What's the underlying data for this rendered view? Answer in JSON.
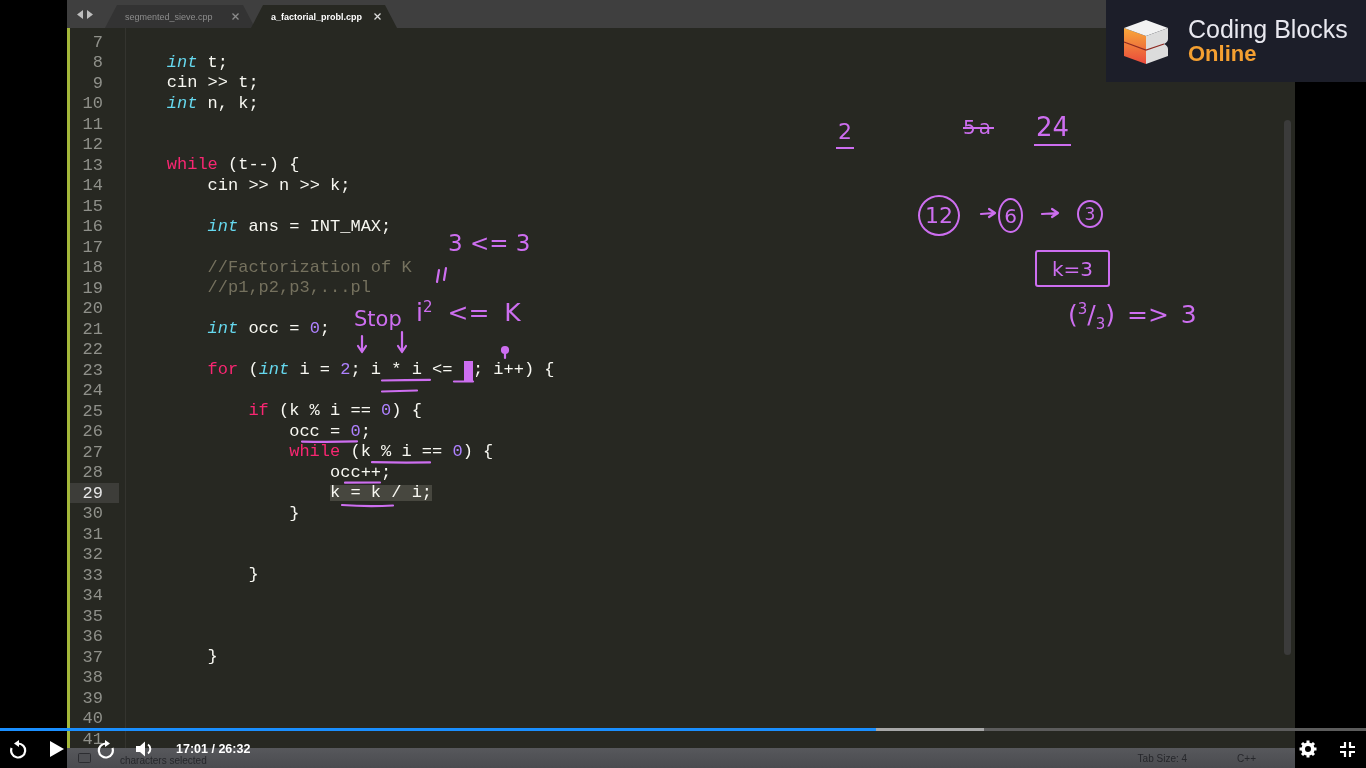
{
  "editor": {
    "tabs": [
      {
        "label": "segmented_sieve.cpp",
        "selected": false
      },
      {
        "label": "a_factorial_probl.cpp",
        "selected": true
      }
    ],
    "lines": [
      {
        "number": "7",
        "selected": false
      },
      {
        "number": "8",
        "selected": false,
        "tokens": [
          {
            "kind": "type",
            "text": "int"
          },
          {
            "kind": "plain",
            "text": " t;"
          }
        ]
      },
      {
        "number": "9",
        "selected": false,
        "tokens": [
          {
            "kind": "plain",
            "text": "cin >> t;"
          }
        ]
      },
      {
        "number": "10",
        "selected": false,
        "tokens": [
          {
            "kind": "type",
            "text": "int"
          },
          {
            "kind": "plain",
            "text": " n, k;"
          }
        ]
      },
      {
        "number": "11",
        "selected": false
      },
      {
        "number": "12",
        "selected": false
      },
      {
        "number": "13",
        "selected": false,
        "tokens": [
          {
            "kind": "keyword",
            "text": "while"
          },
          {
            "kind": "plain",
            "text": " (t--) {"
          }
        ],
        "children": [
          {
            "number": "14",
            "selected": false,
            "tokens": [
              {
                "kind": "plain",
                "text": "cin >> n >> k;"
              }
            ]
          },
          {
            "number": "15",
            "selected": false
          },
          {
            "number": "16",
            "selected": false,
            "tokens": [
              {
                "kind": "type",
                "text": "int"
              },
              {
                "kind": "plain",
                "text": " ans = INT_MAX;"
              }
            ]
          },
          {
            "number": "17",
            "selected": false
          },
          {
            "number": "18",
            "selected": false,
            "tokens": [
              {
                "kind": "comment",
                "text": "//Factorization of K"
              }
            ]
          },
          {
            "number": "19",
            "selected": false,
            "tokens": [
              {
                "kind": "comment",
                "text": "//p1,p2,p3,...pl"
              }
            ]
          },
          {
            "number": "20",
            "selected": false
          },
          {
            "number": "21",
            "selected": false,
            "tokens": [
              {
                "kind": "type",
                "text": "int"
              },
              {
                "kind": "plain",
                "text": " occ = "
              },
              {
                "kind": "number",
                "text": "0"
              },
              {
                "kind": "plain",
                "text": ";"
              }
            ]
          },
          {
            "number": "22",
            "selected": false
          },
          {
            "number": "23",
            "selected": false,
            "tokens": [
              {
                "kind": "keyword",
                "text": "for"
              },
              {
                "kind": "plain",
                "text": " ("
              },
              {
                "kind": "type",
                "text": "int"
              },
              {
                "kind": "plain",
                "text": " i = "
              },
              {
                "kind": "number",
                "text": "2"
              },
              {
                "kind": "plain",
                "text": "; i * i <="
              },
              {
                "kind": "gap"
              },
              {
                "kind": "plain",
                "text": "; i++) {"
              }
            ],
            "children": [
              {
                "number": "24",
                "selected": false
              },
              {
                "number": "25",
                "selected": false,
                "tokens": [
                  {
                    "kind": "keyword",
                    "text": "if"
                  },
                  {
                    "kind": "plain",
                    "text": " (k % i == "
                  },
                  {
                    "kind": "number",
                    "text": "0"
                  },
                  {
                    "kind": "plain",
                    "text": ") {"
                  }
                ],
                "children": [
                  {
                    "number": "26",
                    "selected": false,
                    "tokens": [
                      {
                        "kind": "plain",
                        "text": "occ = "
                      },
                      {
                        "kind": "number",
                        "text": "0"
                      },
                      {
                        "kind": "plain",
                        "text": ";"
                      }
                    ]
                  },
                  {
                    "number": "27",
                    "selected": false,
                    "tokens": [
                      {
                        "kind": "keyword",
                        "text": "while"
                      },
                      {
                        "kind": "plain",
                        "text": " (k % i == "
                      },
                      {
                        "kind": "number",
                        "text": "0"
                      },
                      {
                        "kind": "plain",
                        "text": ") {"
                      }
                    ],
                    "children": [
                      {
                        "number": "28",
                        "selected": false,
                        "tokens": [
                          {
                            "kind": "plain",
                            "text": "occ++;"
                          }
                        ]
                      },
                      {
                        "number": "29",
                        "selected": true,
                        "tokens": [
                          {
                            "kind": "plain",
                            "text": "k = k / i;"
                          }
                        ]
                      }
                    ]
                  },
                  {
                    "number": "30",
                    "selected": false,
                    "tokens": [
                      {
                        "kind": "plain",
                        "text": "}"
                      }
                    ]
                  }
                ]
              },
              {
                "number": "31",
                "selected": false
              },
              {
                "number": "32",
                "selected": false
              },
              {
                "number": "33",
                "selected": false,
                "tokens": [
                  {
                    "kind": "plain",
                    "text": "}"
                  }
                ]
              }
            ]
          },
          {
            "number": "34",
            "selected": false
          },
          {
            "number": "35",
            "selected": false
          },
          {
            "number": "36",
            "selected": false
          },
          {
            "number": "37",
            "selected": false,
            "tokens": [
              {
                "kind": "plain",
                "text": "}"
              }
            ]
          },
          {
            "number": "38",
            "selected": false
          },
          {
            "number": "39",
            "selected": false
          },
          {
            "number": "40",
            "selected": false
          },
          {
            "number": "41",
            "selected": false
          }
        ]
      }
    ],
    "status_bar": {
      "selection": "characters selected",
      "tab_size": "Tab Size: 4",
      "syntax": "C++"
    }
  },
  "annotations": [
    {
      "kind": "plain",
      "text": "3 <= 3"
    },
    {
      "kind": "plain",
      "text": "Stop"
    },
    {
      "kind": "plain",
      "text": "i$^{2}$ <= K"
    },
    {
      "kind": "underlined",
      "text": "2"
    },
    {
      "kind": "struck",
      "text": "5a"
    },
    {
      "kind": "underlined",
      "text": "24"
    },
    {
      "kind": "circled",
      "text": "12"
    },
    {
      "kind": "circled",
      "text": "6"
    },
    {
      "kind": "circled",
      "text": "3"
    },
    {
      "kind": "boxed",
      "text": "k=3"
    },
    {
      "kind": "plain",
      "text": "($^{3}$/$_{3}$) => 3"
    }
  ],
  "logo": {
    "name": "Coding Blocks",
    "tagline": "Online"
  },
  "player": {
    "progress": {
      "level": 0.641
    },
    "buffer": {
      "level": 0.72
    },
    "playing": false,
    "muted": false,
    "time": "17:01 / 26:32"
  }
}
